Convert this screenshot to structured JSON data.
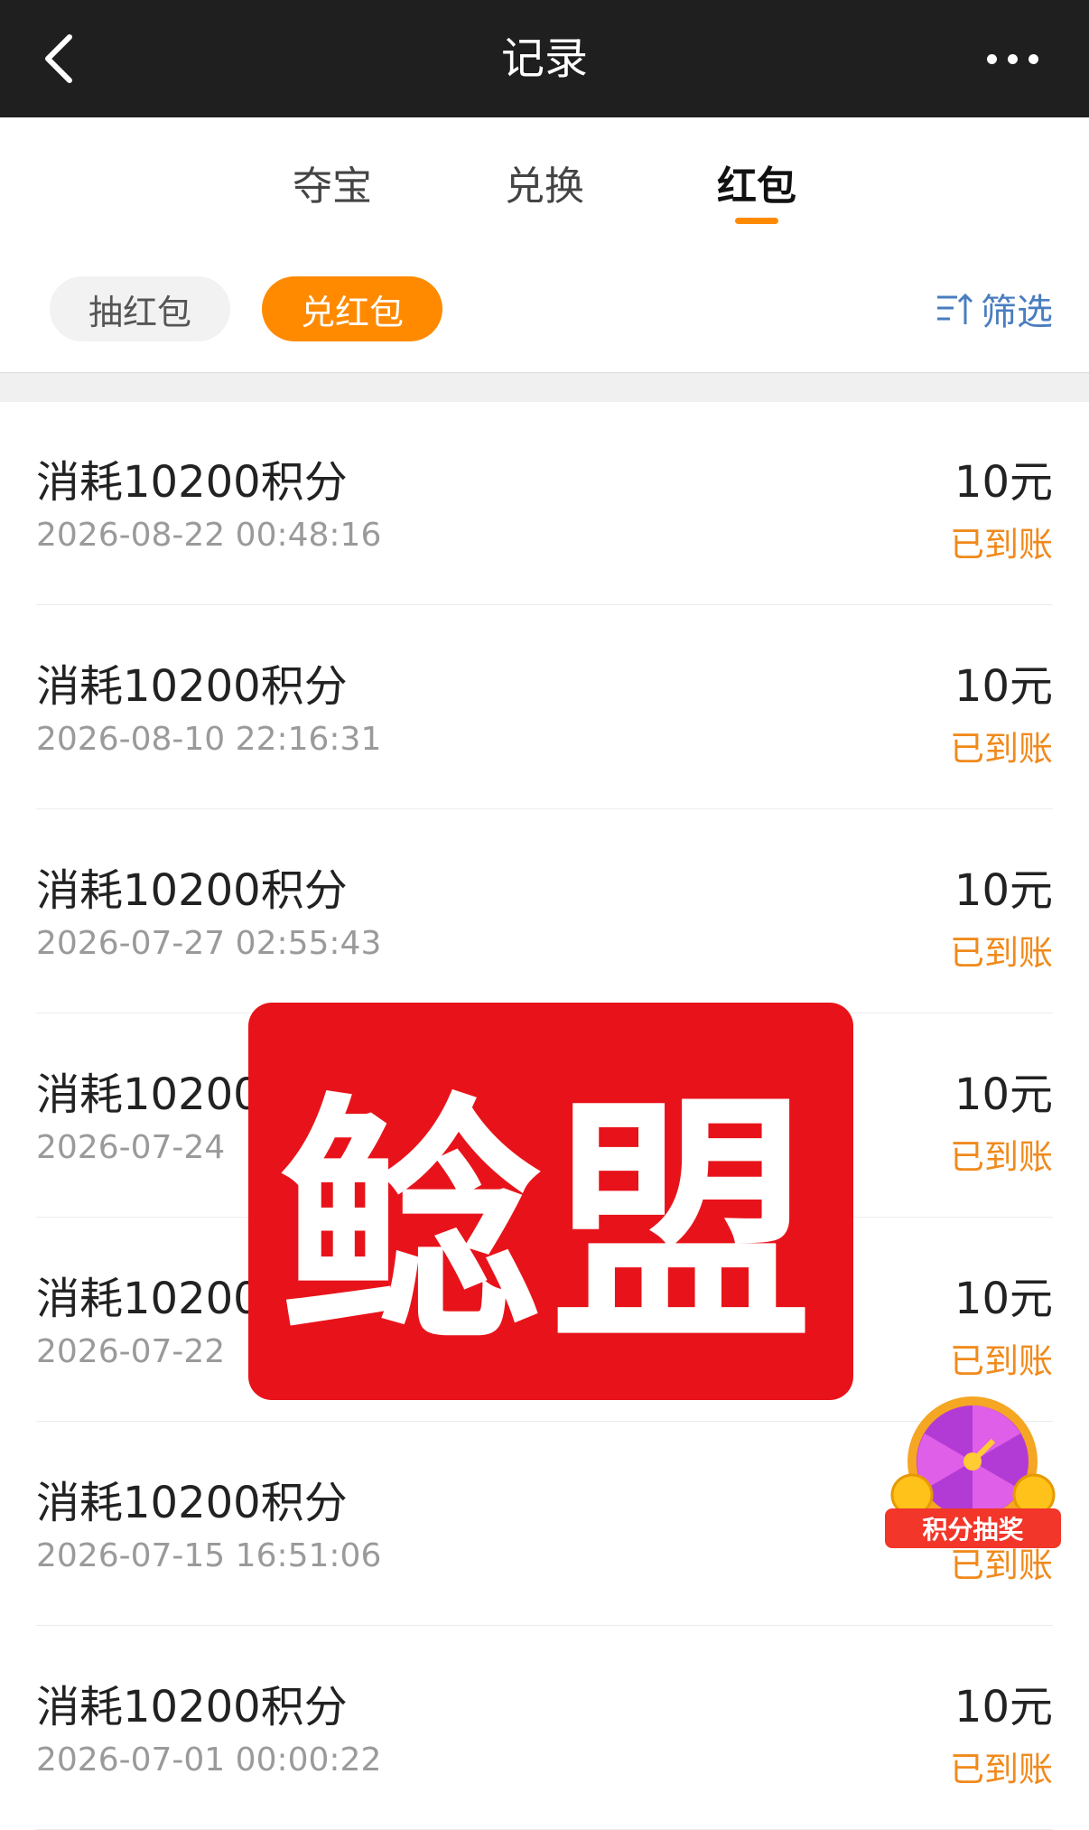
{
  "header": {
    "title": "记录"
  },
  "tabs": [
    {
      "label": "夺宝"
    },
    {
      "label": "兑换"
    },
    {
      "label": "红包"
    }
  ],
  "active_tab": "红包",
  "filters": {
    "chip_draw": "抽红包",
    "chip_redeem": "兑红包",
    "active_chip": "兑红包",
    "filter_label": "筛选"
  },
  "records": [
    {
      "name": "消耗10200积分",
      "time": "2026-08-22 00:48:16",
      "amount": "10元",
      "status": "已到账"
    },
    {
      "name": "消耗10200积分",
      "time": "2026-08-10 22:16:31",
      "amount": "10元",
      "status": "已到账"
    },
    {
      "name": "消耗10200积分",
      "time": "2026-07-27 02:55:43",
      "amount": "10元",
      "status": "已到账"
    },
    {
      "name": "消耗10200",
      "time": "2026-07-24",
      "amount": "10元",
      "status": "已到账"
    },
    {
      "name": "消耗10200",
      "time": "2026-07-22",
      "amount": "10元",
      "status": "已到账"
    },
    {
      "name": "消耗10200积分",
      "time": "2026-07-15 16:51:06",
      "amount": "",
      "status": "已到账"
    },
    {
      "name": "消耗10200积分",
      "time": "2026-07-01 00:00:22",
      "amount": "10元",
      "status": "已到账"
    }
  ],
  "watermark": {
    "text": "鲶盟"
  },
  "floating_button": {
    "label": "积分抽奖"
  },
  "colors": {
    "accent": "#ff8a00",
    "status": "#f08a1c",
    "filter": "#4a7dbf",
    "watermark": "#e8131a"
  }
}
